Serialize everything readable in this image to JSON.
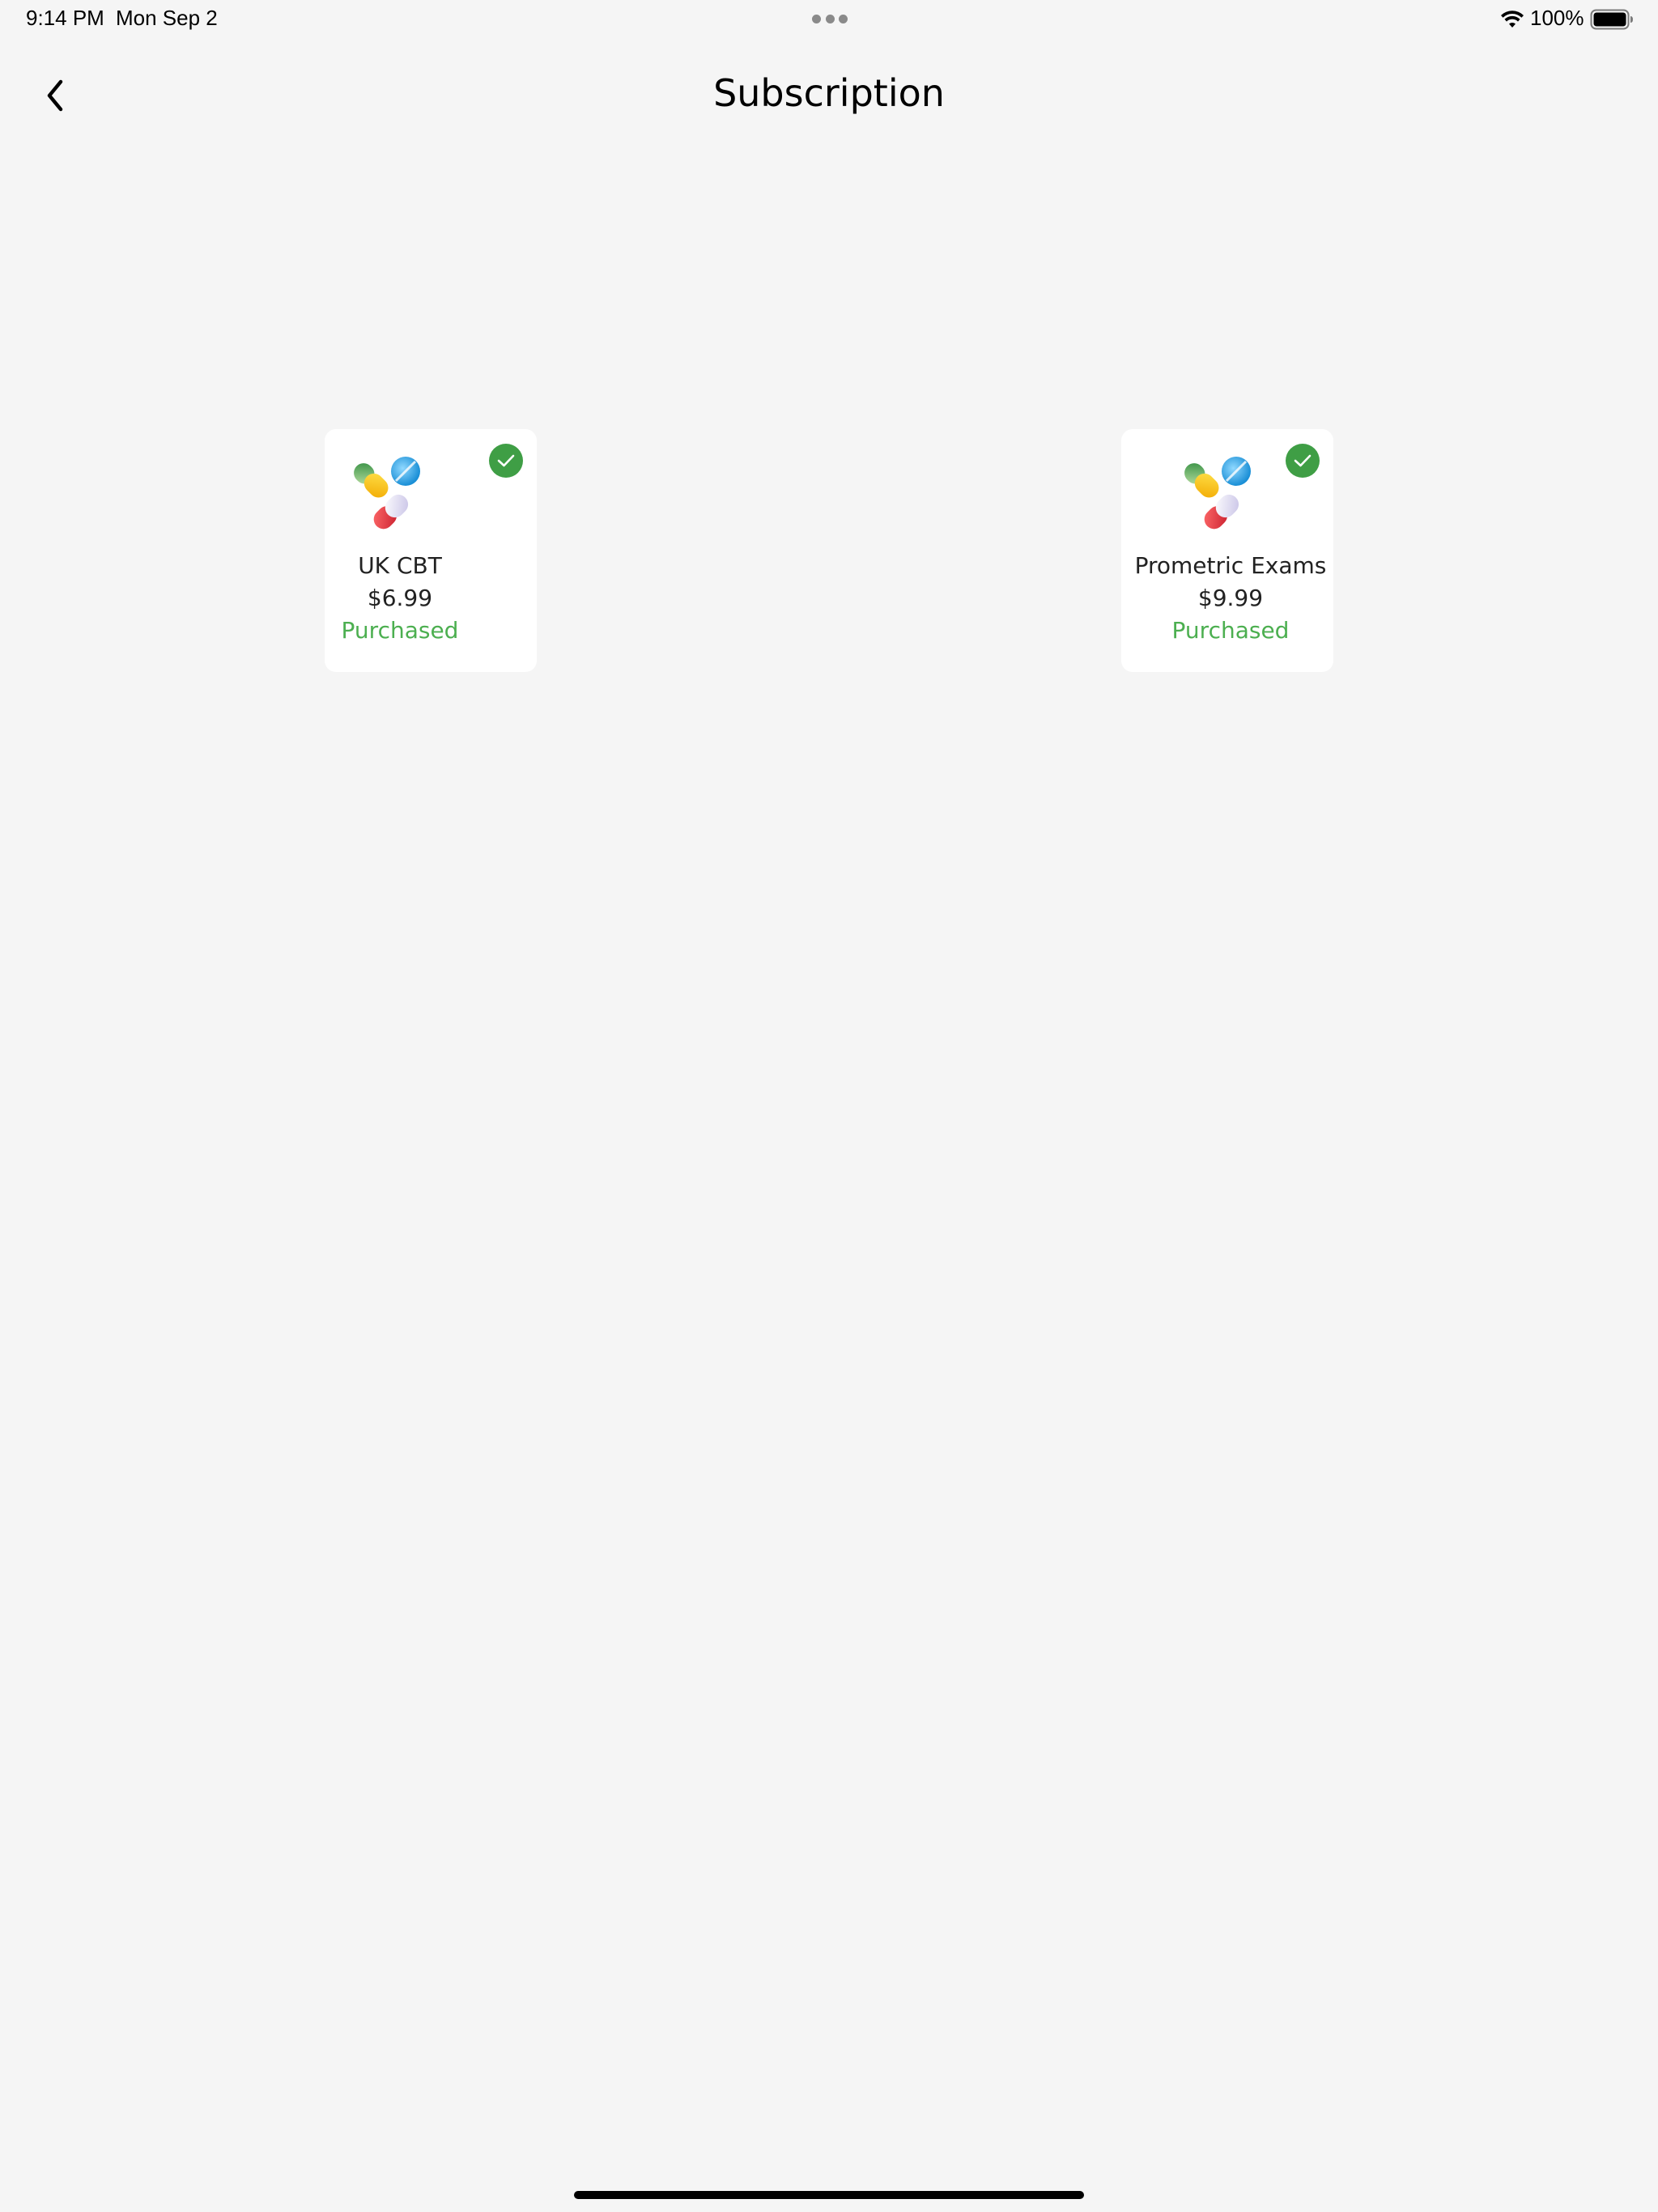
{
  "status_bar": {
    "time": "9:14 PM",
    "date": "Mon Sep 2",
    "battery_percent": "100%",
    "icons": [
      "wifi-icon",
      "battery-icon",
      "multitask-dots-icon"
    ]
  },
  "nav": {
    "title": "Subscription",
    "back_icon": "chevron-left-icon"
  },
  "subscriptions": [
    {
      "name": "UK CBT",
      "price": "$6.99",
      "status": "Purchased",
      "icon": "pills-logo-icon",
      "badge_icon": "checkmark-circle-icon"
    },
    {
      "name": "Prometric Exams",
      "price": "$9.99",
      "status": "Purchased",
      "icon": "pills-logo-icon",
      "badge_icon": "checkmark-circle-icon"
    }
  ],
  "colors": {
    "background": "#f5f5f5",
    "card_background": "#ffffff",
    "purchased_text": "#4caf50",
    "badge": "#3f9e45"
  }
}
